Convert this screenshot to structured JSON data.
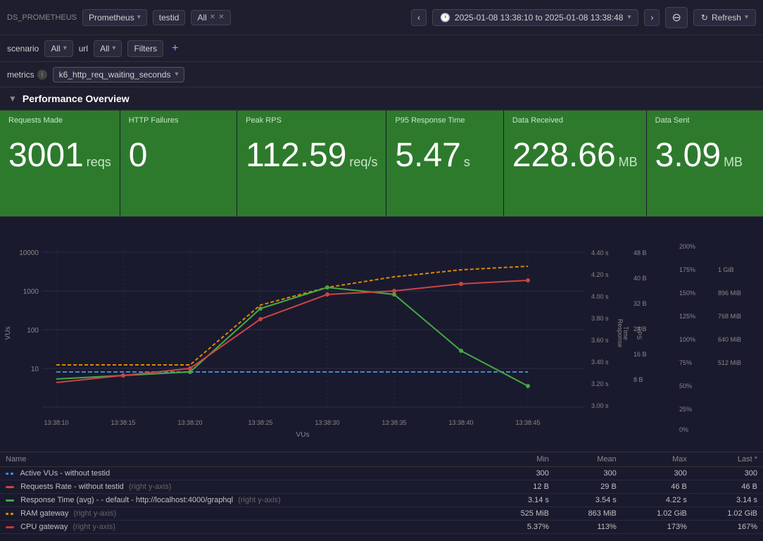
{
  "toolbar": {
    "ds_label": "DS_PROMETHEUS",
    "datasource": "Prometheus",
    "testid_tag": "testid",
    "all_tag": "All",
    "time_range": "2025-01-08 13:38:10 to 2025-01-08 13:38:48",
    "refresh_label": "Refresh",
    "nav_prev": "‹",
    "nav_next": "›",
    "zoom_out": "⊖"
  },
  "filters": {
    "scenario_label": "scenario",
    "scenario_value": "All",
    "url_label": "url",
    "url_value": "All",
    "filters_label": "Filters",
    "add_icon": "+"
  },
  "metrics": {
    "label": "metrics",
    "value": "k6_http_req_waiting_seconds"
  },
  "section": {
    "title": "Performance Overview",
    "chevron": "▼"
  },
  "stat_cards": [
    {
      "title": "Requests Made",
      "number": "3001",
      "unit": "reqs"
    },
    {
      "title": "HTTP Failures",
      "number": "0",
      "unit": ""
    },
    {
      "title": "Peak RPS",
      "number": "112.59",
      "unit": "req/s"
    },
    {
      "title": "P95 Response Time",
      "number": "5.47",
      "unit": "s"
    },
    {
      "title": "Data Received",
      "number": "228.66",
      "unit": "MB"
    },
    {
      "title": "Data Sent",
      "number": "3.09",
      "unit": "MB"
    }
  ],
  "chart": {
    "y_left_label": "VUs",
    "y_left_ticks": [
      "10000",
      "1000",
      "100",
      "10"
    ],
    "x_ticks": [
      "13:38:10",
      "13:38:15",
      "13:38:20",
      "13:38:25",
      "13:38:30",
      "13:38:35",
      "13:38:40",
      "13:38:45"
    ],
    "x_label": "VUs",
    "y_right_b_ticks": [
      "48 B",
      "40 B",
      "32 B",
      "24 B",
      "16 B",
      "8 B"
    ],
    "y_right_rps_ticks": [
      "4.40 s",
      "4.20 s",
      "4.00 s",
      "3.80 s",
      "3.60 s",
      "3.40 s",
      "3.20 s",
      "3.00 s"
    ],
    "y_right_labels": [
      "RPS",
      "Response",
      "Time"
    ],
    "y_far_right_ticks": [
      "200%",
      "175%",
      "150%",
      "125%",
      "100%",
      "75%",
      "50%",
      "25%",
      "0%"
    ],
    "y_far_right_mib": [
      "1 GiB",
      "896 MiB",
      "768 MiB",
      "640 MiB",
      "512 MiB"
    ]
  },
  "legend": {
    "columns": [
      "Name",
      "Min",
      "Mean",
      "Max",
      "Last *"
    ],
    "rows": [
      {
        "color": "#1a6aaa",
        "color_style": "dashed",
        "name": "Active VUs - without testid",
        "suffix": "",
        "min": "300",
        "mean": "300",
        "max": "300",
        "last": "300"
      },
      {
        "color": "#cc4444",
        "color_style": "solid",
        "name": "Requests Rate - without testid",
        "suffix": "(right y-axis)",
        "min": "12 B",
        "mean": "29 B",
        "max": "46 B",
        "last": "46 B"
      },
      {
        "color": "#44aa44",
        "color_style": "solid",
        "name": "Response Time (avg) - - default - http://localhost:4000/graphql",
        "suffix": "(right y-axis)",
        "min": "3.14 s",
        "mean": "3.54 s",
        "max": "4.22 s",
        "last": "3.14 s"
      },
      {
        "color": "#dd8800",
        "color_style": "dashed",
        "name": "RAM gateway",
        "suffix": "(right y-axis)",
        "min": "525 MiB",
        "mean": "863 MiB",
        "max": "1.02 GiB",
        "last": "1.02 GiB"
      },
      {
        "color": "#cc3333",
        "color_style": "solid",
        "name": "CPU gateway",
        "suffix": "(right y-axis)",
        "min": "5.37%",
        "mean": "113%",
        "max": "173%",
        "last": "167%"
      }
    ]
  }
}
